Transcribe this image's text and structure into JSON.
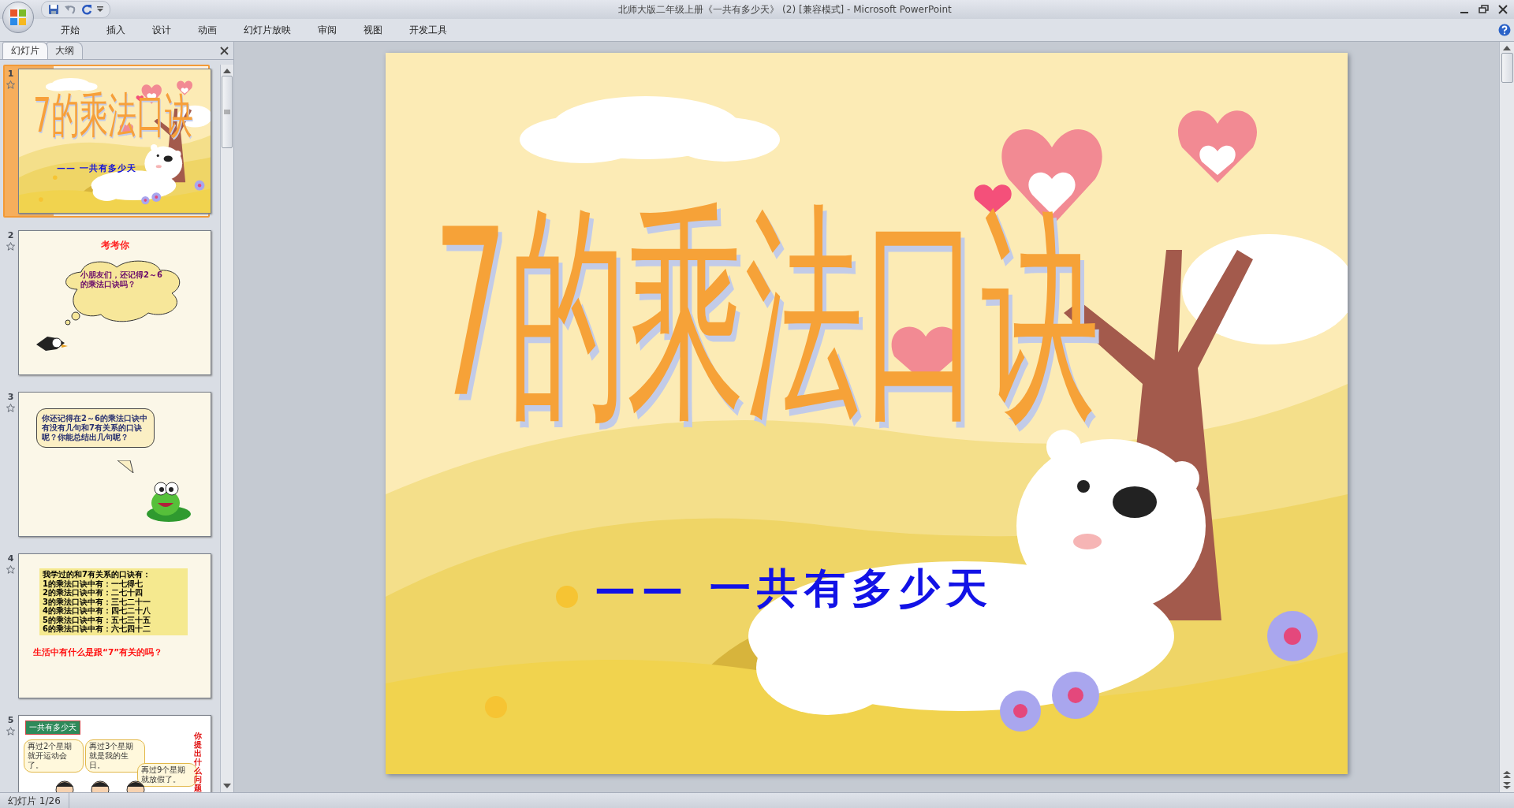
{
  "window": {
    "title": "北师大版二年级上册《一共有多少天》 (2) [兼容模式] - Microsoft PowerPoint"
  },
  "ribbon_tabs": [
    {
      "label": "开始"
    },
    {
      "label": "插入"
    },
    {
      "label": "设计"
    },
    {
      "label": "动画"
    },
    {
      "label": "幻灯片放映"
    },
    {
      "label": "审阅"
    },
    {
      "label": "视图"
    },
    {
      "label": "开发工具"
    }
  ],
  "panel_tabs": [
    {
      "label": "幻灯片",
      "selected": true
    },
    {
      "label": "大纲",
      "selected": false
    }
  ],
  "thumbnails": [
    {
      "number": "1",
      "selected": true,
      "kind": "title",
      "title": "7的乘法口诀",
      "subtitle": "—— 一共有多少天"
    },
    {
      "number": "2",
      "selected": false,
      "kind": "thought",
      "heading": "考考你",
      "text": "小朋友们，还记得2～6的乘法口诀吗？"
    },
    {
      "number": "3",
      "selected": false,
      "kind": "speech",
      "text": "你还记得在2～6的乘法口诀中有没有几句和7有关系的口诀呢？你能总结出几句呢？"
    },
    {
      "number": "4",
      "selected": false,
      "kind": "list",
      "lines": [
        "我学过的和7有关系的口诀有：",
        "1的乘法口诀中有：一七得七",
        "2的乘法口诀中有：二七十四",
        "3的乘法口诀中有：三七二十一",
        "4的乘法口诀中有：四七二十八",
        "5的乘法口诀中有：五七三十五",
        "6的乘法口诀中有：六七四十二"
      ],
      "question": "生活中有什么是跟“7”有关的吗？"
    },
    {
      "number": "5",
      "selected": false,
      "kind": "comic",
      "label": "一共有多少天",
      "bubbles": [
        "再过2个星期就开运动会了。",
        "再过3个星期就是我的生日。",
        "再过9个星期就放假了。"
      ],
      "side_text": "你提出什么问题"
    }
  ],
  "slide": {
    "title": "7的乘法口诀",
    "subtitle": "—— 一共有多少天"
  },
  "status_bar": {
    "slide_indicator": "幻灯片 1/26"
  }
}
